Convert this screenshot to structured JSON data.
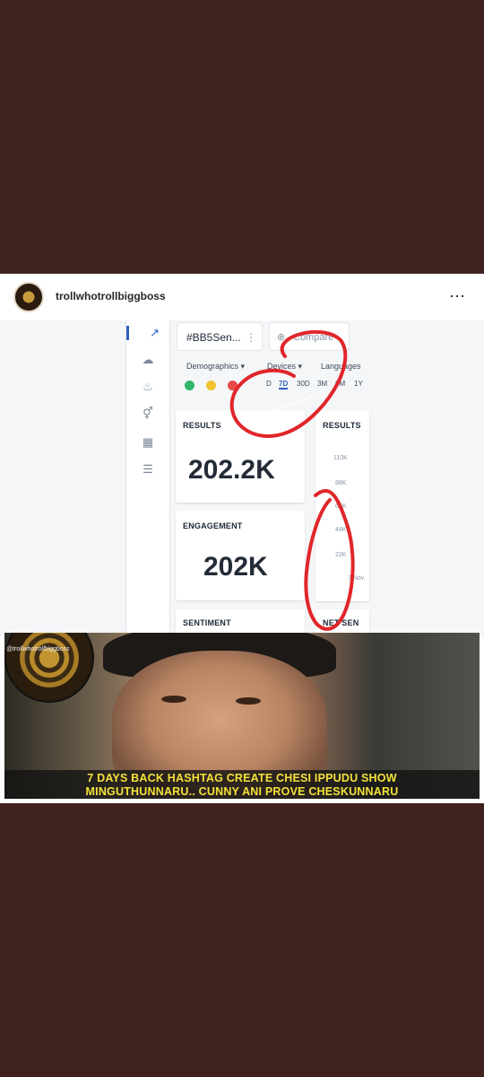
{
  "post": {
    "username": "trollwhotrollbiggboss",
    "more_icon": "⋯"
  },
  "screenshot": {
    "hashtag_chip": "#BB5Sen...",
    "compare_chip": "Compare",
    "filters": {
      "demographics": "Demographics",
      "devices": "Devices",
      "languages": "Languages"
    },
    "ranges": [
      "D",
      "7D",
      "30D",
      "3M",
      "6M",
      "1Y"
    ],
    "active_range": "7D",
    "results_label": "RESULTS",
    "results_value": "202.2K",
    "results2_label": "RESULTS",
    "engagement_label": "ENGAGEMENT",
    "engagement_value": "202K",
    "sentiment_label": "SENTIMENT",
    "net_sentiment_label": "NET SEN",
    "chart_ticks": [
      "110K",
      "88K",
      "66K",
      "44K",
      "22K"
    ],
    "chart_x_label": "7 Nov",
    "nav_icons": [
      "trend-icon",
      "cloud-icon",
      "influence-icon",
      "gender-icon",
      "map-icon",
      "list-icon"
    ],
    "annotation_color": "#e0262a"
  },
  "meme": {
    "watermark": "@trollwhotrollbiggboss",
    "caption_line1": "7 DAYS BACK HASHTAG CREATE CHESI IPPUDU SHOW",
    "caption_line2": "MINGUTHUNNARU.. CUNNY ANI PROVE CHESKUNNARU",
    "caption_color": "#f4e23a"
  }
}
